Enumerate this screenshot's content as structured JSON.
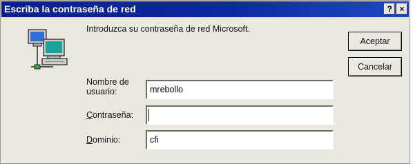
{
  "window": {
    "title": "Escriba la contraseña de red",
    "help_button": "?",
    "close_button": "×"
  },
  "dialog": {
    "message": "Introduzca su contraseña de red Microsoft.",
    "fields": {
      "username": {
        "label_line1": "Nombre de",
        "label_line2": "usuario:",
        "value": "mrebollo"
      },
      "password": {
        "label_mnemonic": "C",
        "label_rest": "ontraseña:",
        "value": ""
      },
      "domain": {
        "label_mnemonic": "D",
        "label_rest": "ominio:",
        "value": "cfi"
      }
    },
    "buttons": {
      "accept": "Aceptar",
      "cancel": "Cancelar"
    },
    "icon": "network-computer-icon"
  },
  "colors": {
    "title_bar": "#0a2a9e",
    "window_bg": "#ece7e0",
    "field_bg": "#ffffff"
  }
}
